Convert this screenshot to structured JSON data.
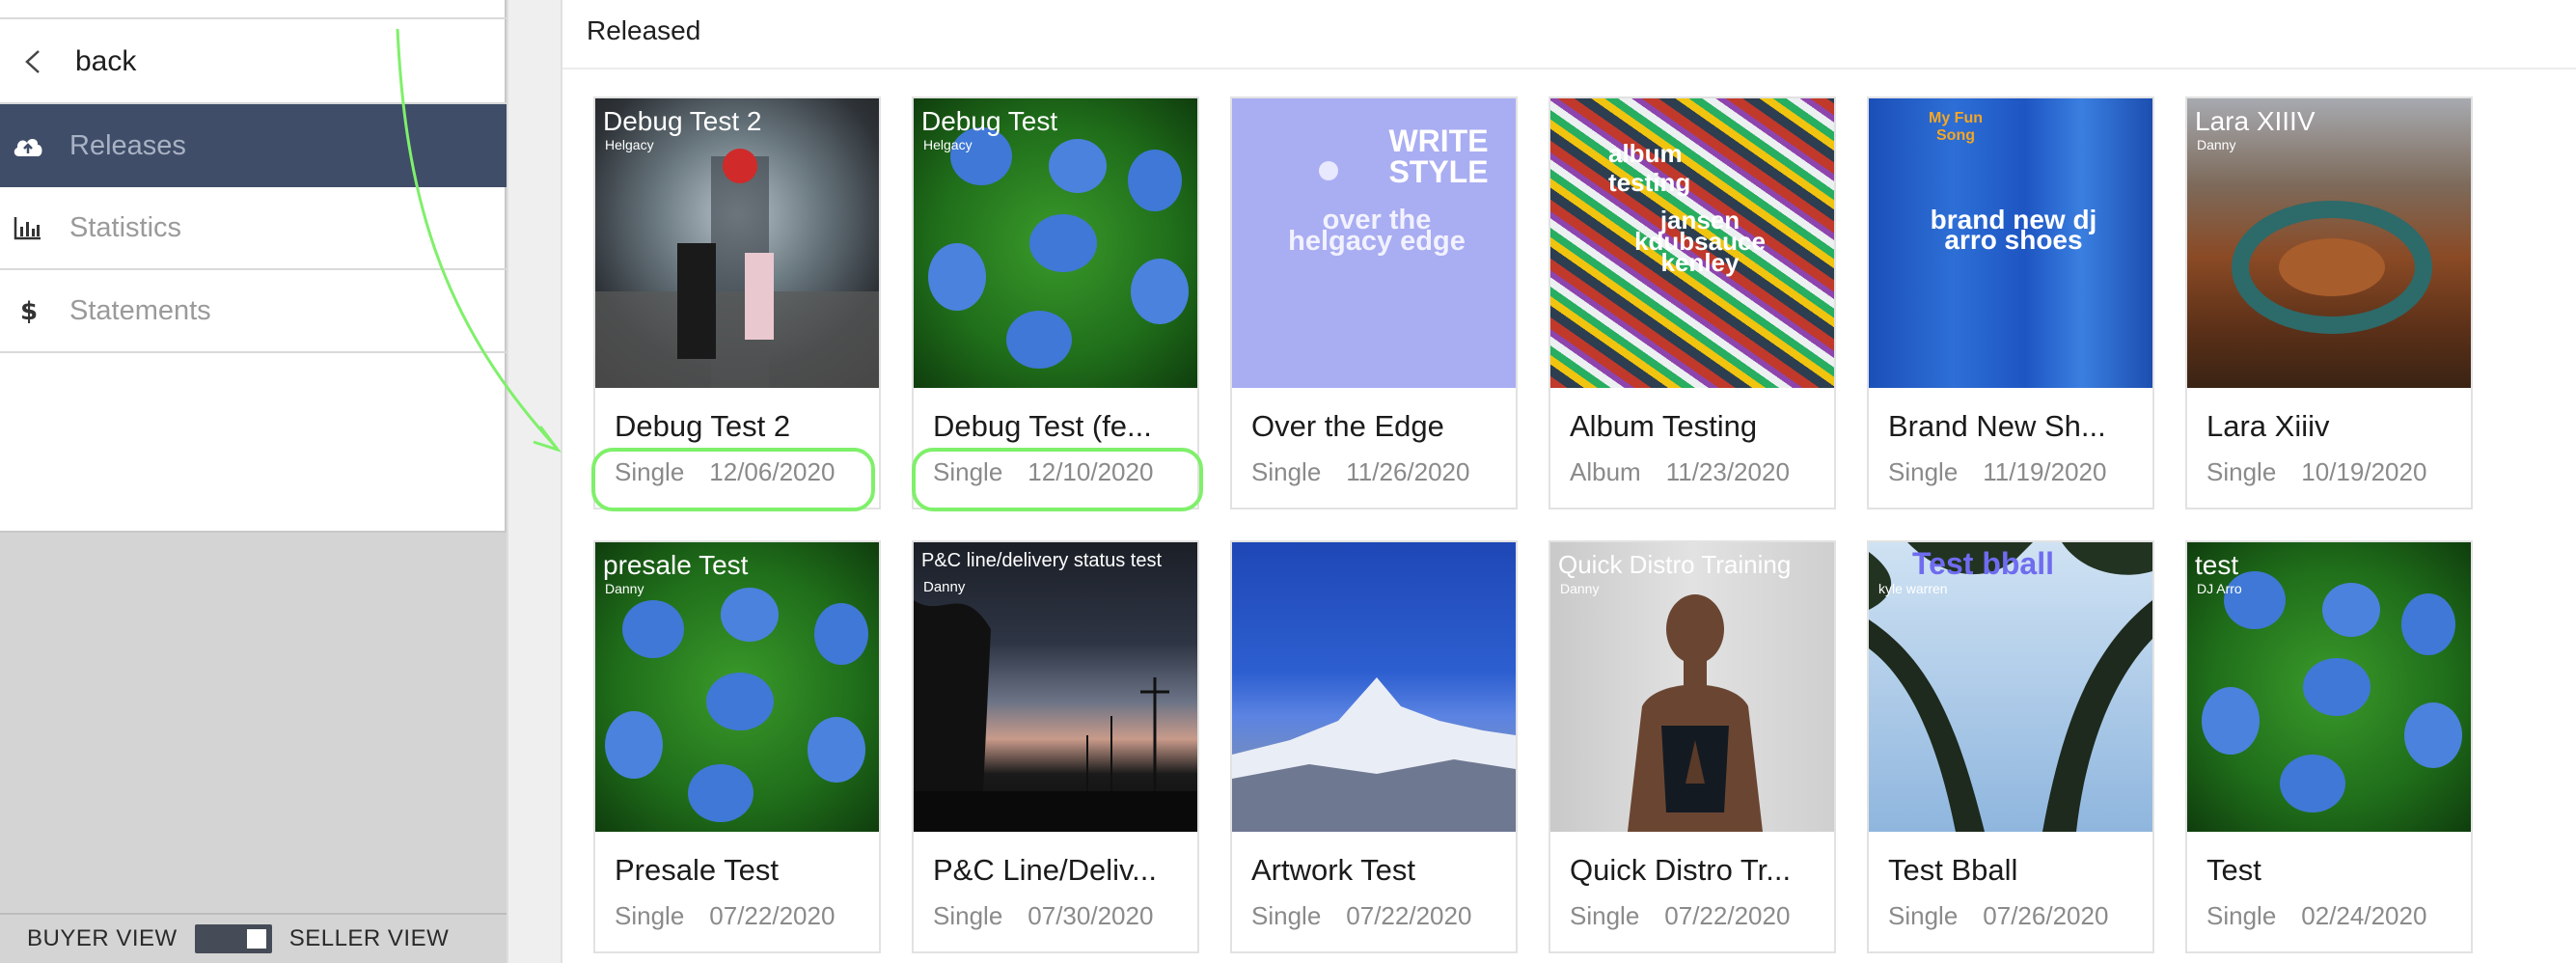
{
  "sidebar": {
    "back_label": "back",
    "items": [
      {
        "label": "Releases",
        "icon": "cloud-upload-icon",
        "active": true
      },
      {
        "label": "Statistics",
        "icon": "bar-chart-icon",
        "active": false
      },
      {
        "label": "Statements",
        "icon": "dollar-icon",
        "active": false
      }
    ],
    "toggle": {
      "left_label": "BUYER VIEW",
      "right_label": "SELLER VIEW"
    }
  },
  "main": {
    "section_title": "Released",
    "releases": [
      {
        "title": "Debug Test 2",
        "type": "Single",
        "date": "12/06/2020",
        "art_title": "Debug Test 2",
        "art_sub": "Helgacy"
      },
      {
        "title": "Debug Test (fe...",
        "type": "Single",
        "date": "12/10/2020",
        "art_title": "Debug Test",
        "art_sub": "Helgacy"
      },
      {
        "title": "Over the Edge",
        "type": "Single",
        "date": "11/26/2020",
        "art_title": "WRITE STYLE",
        "art_sub": "over the helgacy edge"
      },
      {
        "title": "Album Testing",
        "type": "Album",
        "date": "11/23/2020",
        "art_title": "album testing",
        "art_sub": "jansen kdubsauce kenley"
      },
      {
        "title": "Brand New Sh...",
        "type": "Single",
        "date": "11/19/2020",
        "art_title": "My Fun Song",
        "art_sub": "brand new dj arro shoes"
      },
      {
        "title": "Lara Xiiiv",
        "type": "Single",
        "date": "10/19/2020",
        "art_title": "Lara XIIIV",
        "art_sub": "Danny"
      },
      {
        "title": "Presale Test",
        "type": "Single",
        "date": "07/22/2020",
        "art_title": "presale Test",
        "art_sub": "Danny"
      },
      {
        "title": "P&C Line/Deliv...",
        "type": "Single",
        "date": "07/30/2020",
        "art_title": "P&C line/delivery status test",
        "art_sub": "Danny"
      },
      {
        "title": "Artwork Test",
        "type": "Single",
        "date": "07/22/2020",
        "art_title": "",
        "art_sub": ""
      },
      {
        "title": "Quick Distro Tr...",
        "type": "Single",
        "date": "07/22/2020",
        "art_title": "Quick Distro Training",
        "art_sub": "Danny"
      },
      {
        "title": "Test Bball",
        "type": "Single",
        "date": "07/26/2020",
        "art_title": "Test bball",
        "art_sub": "kyle warren"
      },
      {
        "title": "Test",
        "type": "Single",
        "date": "02/24/2020",
        "art_title": "test",
        "art_sub": "DJ Arro"
      }
    ]
  },
  "annotation_color": "#7ff06a"
}
